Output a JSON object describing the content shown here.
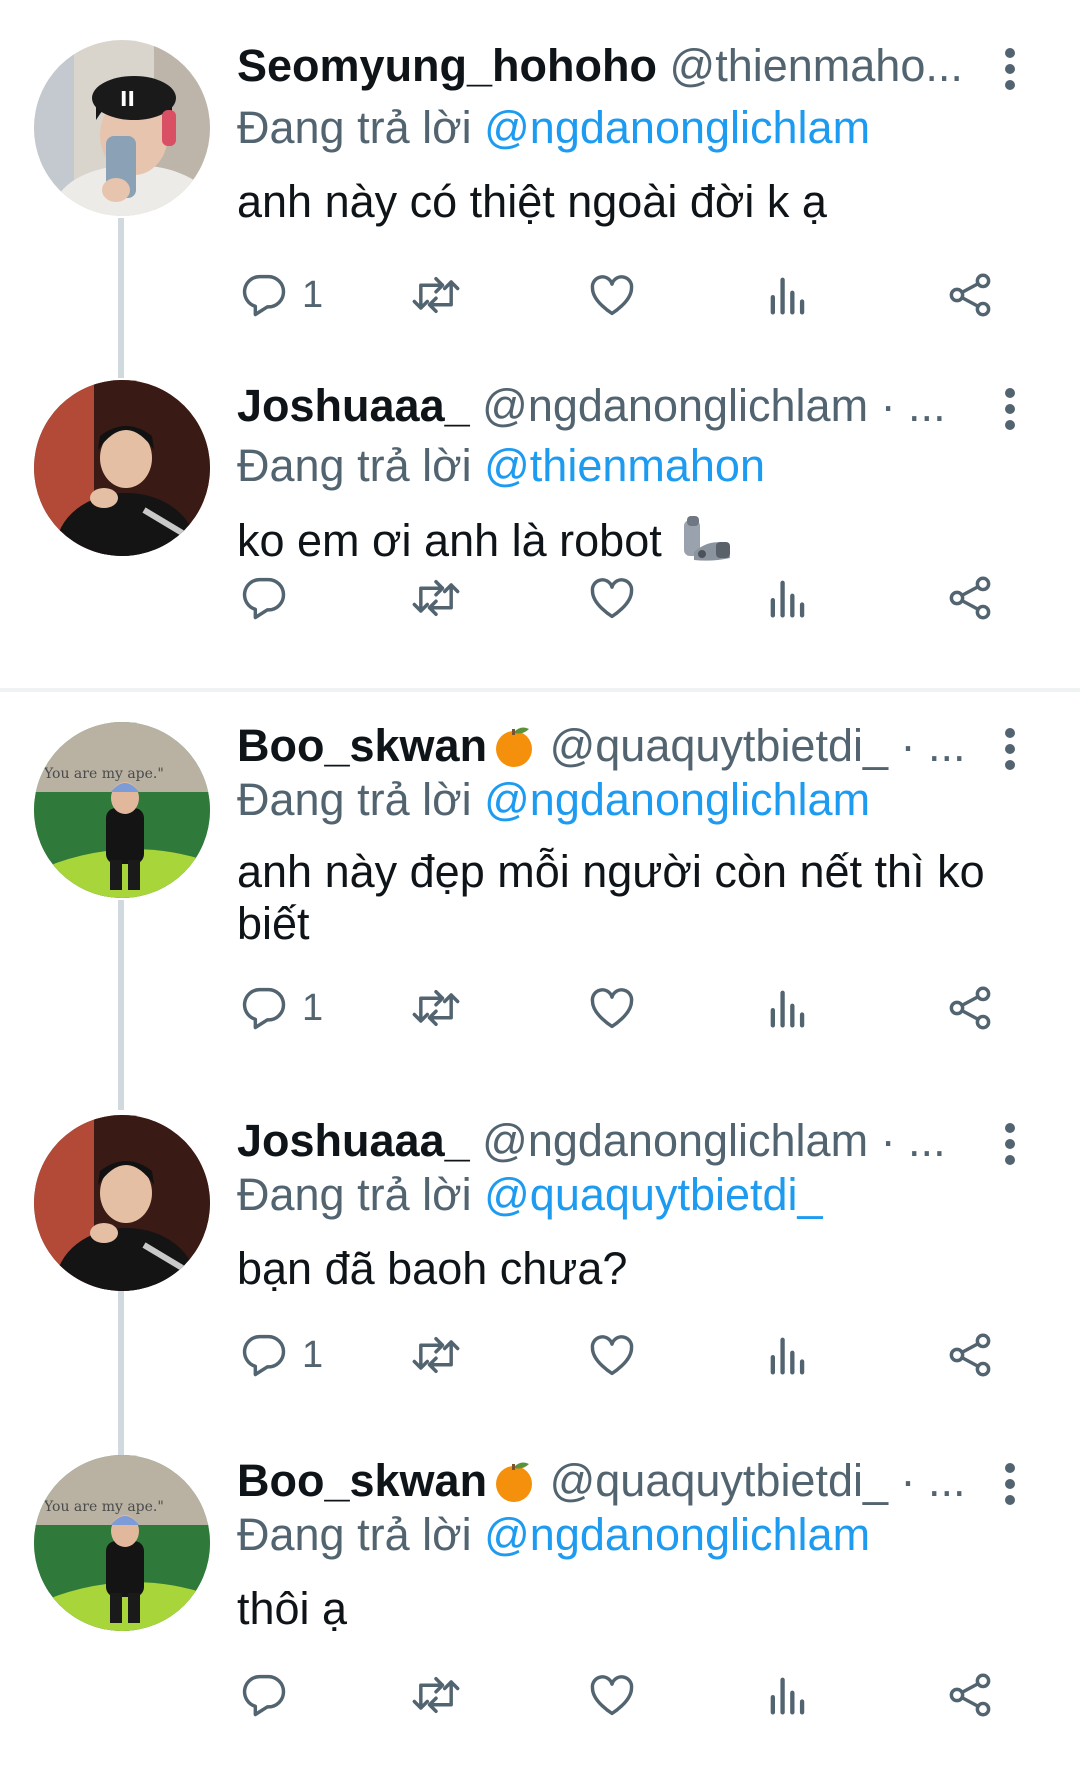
{
  "tweets": [
    {
      "name": "Seomyung_hohoho",
      "handle": "@thienmaho...",
      "replying_prefix": "Đang trả lời",
      "replying_to": "@ngdanonglichlam",
      "text": "anh này có thiệt ngoài đời k ạ",
      "reply_count": "1",
      "has_orange_emoji": false
    },
    {
      "name": "Joshuaaa_",
      "handle": "@ngdanonglichlam · ...",
      "replying_prefix": "Đang trả lời",
      "replying_to": "@thienmahon",
      "text": "ko em ơi anh là robot",
      "reply_count": "",
      "has_orange_emoji": false
    },
    {
      "name": "Boo_skwan",
      "handle": "@quaquytbietdi_ · ...",
      "replying_prefix": "Đang trả lời",
      "replying_to": "@ngdanonglichlam",
      "text": "anh này đẹp mỗi người còn nết thì ko biết",
      "reply_count": "1",
      "has_orange_emoji": true
    },
    {
      "name": "Joshuaaa_",
      "handle": "@ngdanonglichlam · ...",
      "replying_prefix": "Đang trả lời",
      "replying_to": "@quaquytbietdi_",
      "text": "bạn đã baoh chưa?",
      "reply_count": "1",
      "has_orange_emoji": false
    },
    {
      "name": "Boo_skwan",
      "handle": "@quaquytbietdi_ · ...",
      "replying_prefix": "Đang trả lời",
      "replying_to": "@ngdanonglichlam",
      "text": "thôi ạ",
      "reply_count": "",
      "has_orange_emoji": true
    }
  ],
  "avatar_sign_text": "You are my  ape.\"",
  "icons": [
    "reply-icon",
    "retweet-icon",
    "like-icon",
    "views-icon",
    "share-icon",
    "more-icon"
  ],
  "colors": {
    "accent": "#1d9bf0",
    "secondary_text": "#536471",
    "thread_line": "#cfd9de"
  }
}
